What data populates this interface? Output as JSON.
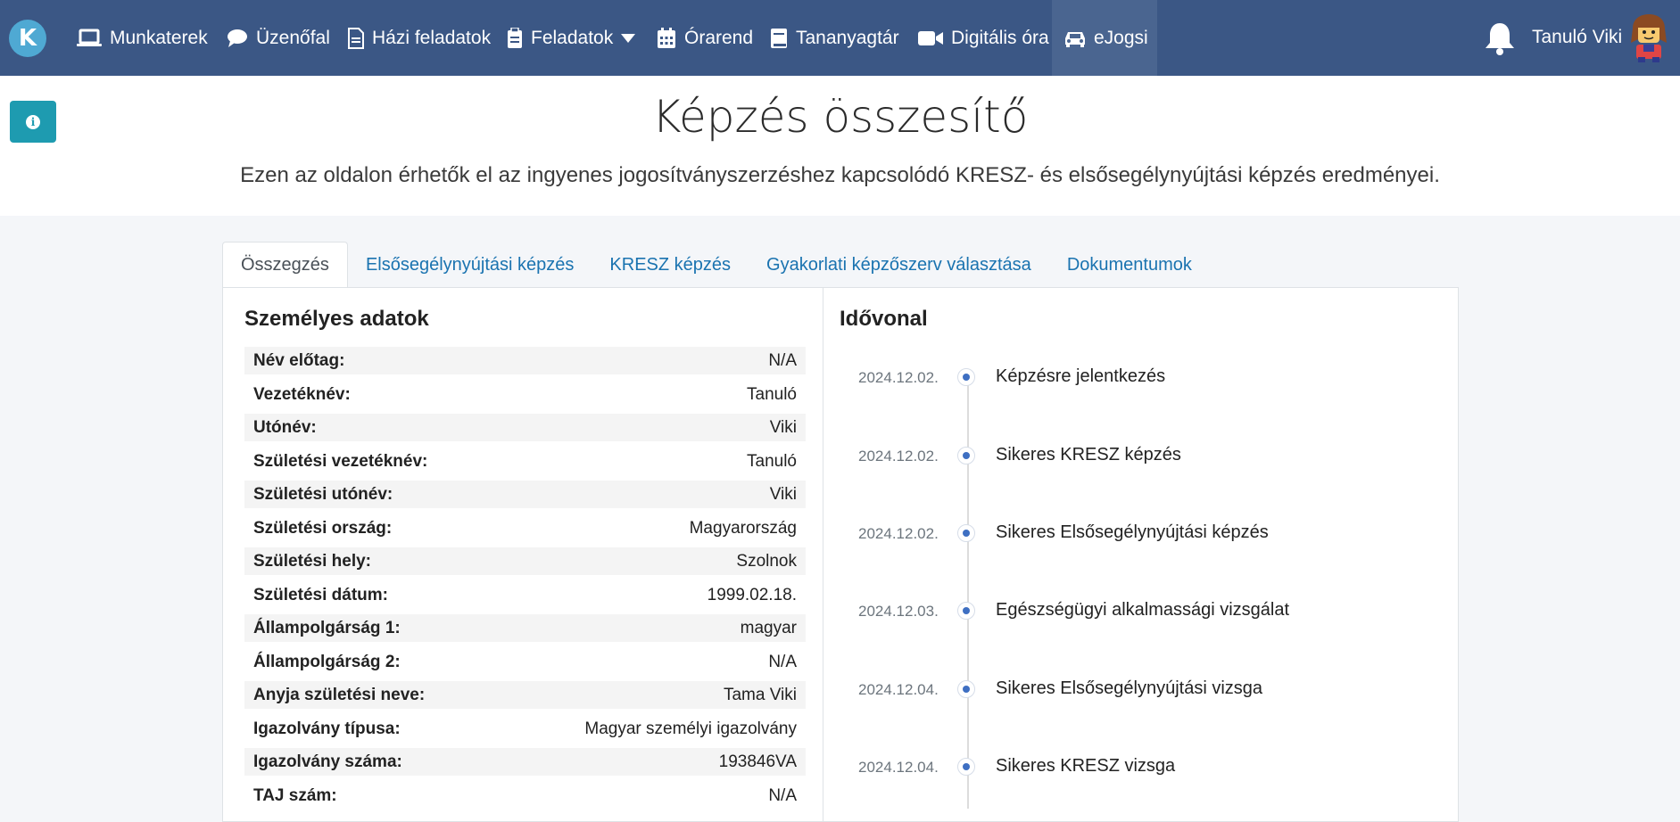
{
  "nav": {
    "logo_letter": "K",
    "items": [
      {
        "label": "Munkaterek",
        "icon": "laptop-icon"
      },
      {
        "label": "Üzenőfal",
        "icon": "comment-icon"
      },
      {
        "label": "Házi feladatok",
        "icon": "file-icon"
      },
      {
        "label": "Feladatok",
        "icon": "clipboard-icon"
      },
      {
        "label": "Órarend",
        "icon": "calendar-icon"
      },
      {
        "label": "Tananyagtár",
        "icon": "book-icon"
      },
      {
        "label": "Digitális óra",
        "icon": "video-icon"
      },
      {
        "label": "eJogsi",
        "icon": "car-icon"
      }
    ],
    "user_name": "Tanuló Viki"
  },
  "header": {
    "title": "Képzés összesítő",
    "subtitle": "Ezen az oldalon érhetők el az ingyenes jogosítványszerzéshez kapcsolódó KRESZ- és elsősegélynyújtási képzés eredményei."
  },
  "tabs": [
    "Összegzés",
    "Elsősegélynyújtási képzés",
    "KRESZ képzés",
    "Gyakorlati képzőszerv választása",
    "Dokumentumok"
  ],
  "personal": {
    "title": "Személyes adatok",
    "rows": [
      {
        "label": "Név előtag:",
        "value": "N/A"
      },
      {
        "label": "Vezetéknév:",
        "value": "Tanuló"
      },
      {
        "label": "Utónév:",
        "value": "Viki"
      },
      {
        "label": "Születési vezetéknév:",
        "value": "Tanuló"
      },
      {
        "label": "Születési utónév:",
        "value": "Viki"
      },
      {
        "label": "Születési ország:",
        "value": "Magyarország"
      },
      {
        "label": "Születési hely:",
        "value": "Szolnok"
      },
      {
        "label": "Születési dátum:",
        "value": "1999.02.18."
      },
      {
        "label": "Állampolgárság 1:",
        "value": "magyar"
      },
      {
        "label": "Állampolgárság 2:",
        "value": "N/A"
      },
      {
        "label": "Anyja születési neve:",
        "value": "Tama Viki"
      },
      {
        "label": "Igazolvány típusa:",
        "value": "Magyar személyi igazolvány"
      },
      {
        "label": "Igazolvány száma:",
        "value": "193846VA"
      },
      {
        "label": "TAJ szám:",
        "value": "N/A"
      }
    ]
  },
  "timeline": {
    "title": "Idővonal",
    "items": [
      {
        "date": "2024.12.02.",
        "text": "Képzésre jelentkezés"
      },
      {
        "date": "2024.12.02.",
        "text": "Sikeres KRESZ képzés"
      },
      {
        "date": "2024.12.02.",
        "text": "Sikeres Elsősegélynyújtási képzés"
      },
      {
        "date": "2024.12.03.",
        "text": "Egészségügyi alkalmassági vizsgálat"
      },
      {
        "date": "2024.12.04.",
        "text": "Sikeres Elsősegélynyújtási vizsga"
      },
      {
        "date": "2024.12.04.",
        "text": "Sikeres KRESZ vizsga"
      }
    ]
  }
}
